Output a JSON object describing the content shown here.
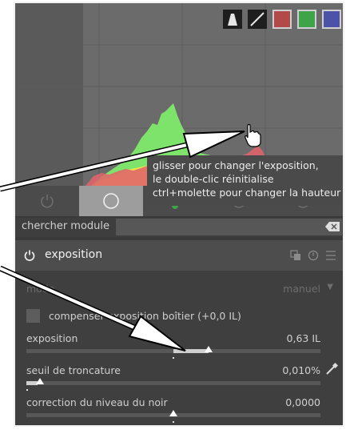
{
  "histogram": {
    "icons": [
      "scope-histogram-icon",
      "linear-scale-icon",
      "red-channel-icon",
      "green-channel-icon",
      "blue-channel-icon"
    ],
    "colors": {
      "red": "#e0646b",
      "green": "#7ee36b",
      "yellow": "#ece64a"
    }
  },
  "tooltip": {
    "lines": [
      "glisser pour changer l'exposition,",
      "le double-clic réinitialise",
      "ctrl+molette pour changer la hauteur"
    ]
  },
  "search": {
    "label": "chercher module",
    "placeholder": ""
  },
  "module": {
    "title": "exposition",
    "mode_label": "mode",
    "mode_value": "manuel",
    "compensate_label": "compenser exposition boîtier (+0,0 IL)",
    "exposure_label": "exposition",
    "exposure_value": "0,63 IL",
    "exposure_fraction": 0.62,
    "clip_label": "seuil de troncature",
    "clip_value": "0,010%",
    "black_label": "correction du niveau du noir",
    "black_value": "0,0000"
  },
  "colors": {
    "accent": "#ffffff",
    "panel": "#3a3a3a",
    "histogram_bg": "#6b6b6b",
    "tab_active": "#9d9d9d"
  }
}
